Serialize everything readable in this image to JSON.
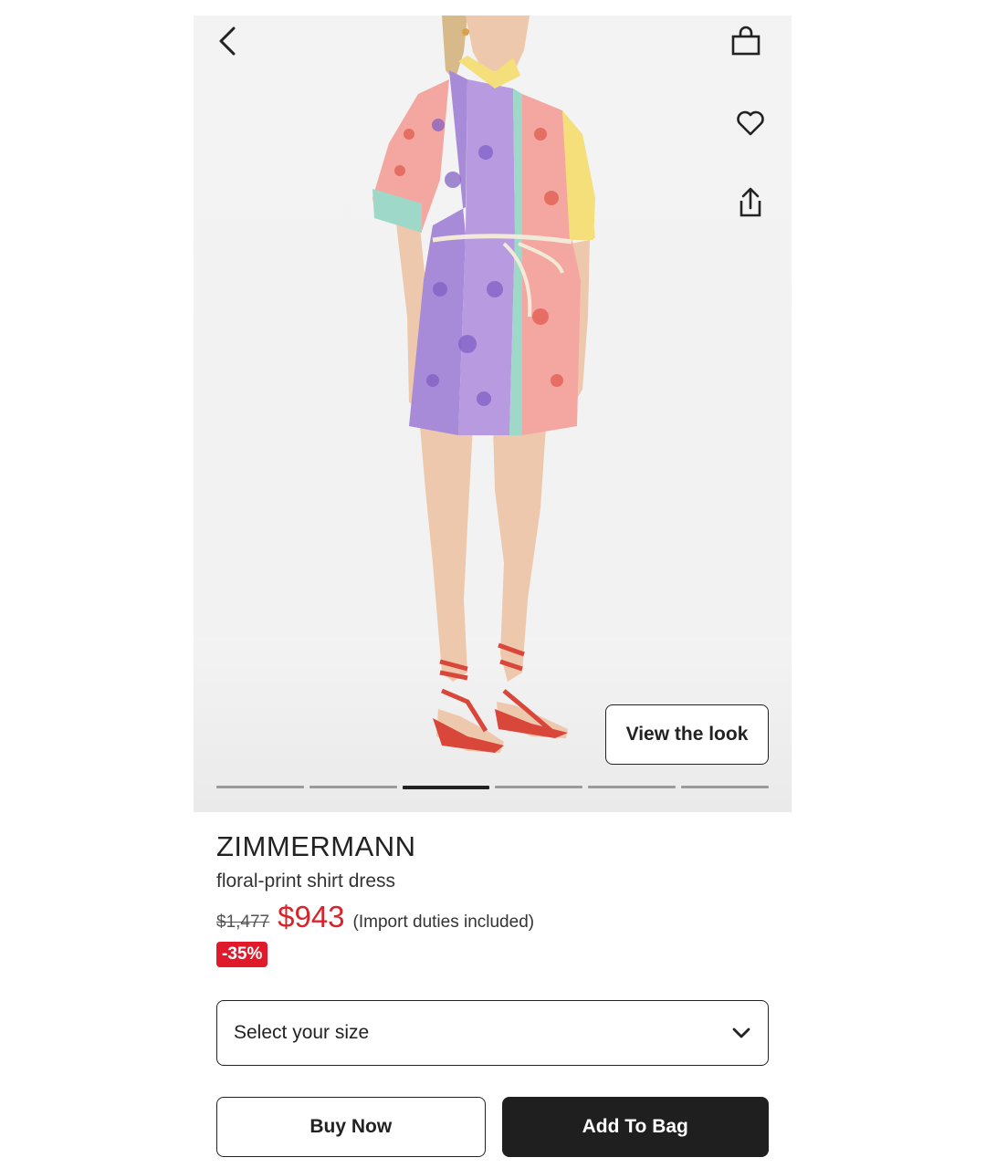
{
  "gallery": {
    "view_look_label": "View the look",
    "image_count": 6,
    "active_index": 2,
    "colors": {
      "background": "#f2f2f2",
      "skin": "#eec8ad",
      "hair": "#d8b98a",
      "sandal": "#d9463a",
      "purple": "#a78bd8",
      "pink": "#f4a7a0",
      "mint": "#9ed8c8",
      "yellow": "#f4df7a"
    }
  },
  "header": {
    "icons": [
      "chevron-left-icon",
      "shopping-bag-icon",
      "heart-icon",
      "share-icon"
    ]
  },
  "product": {
    "brand": "ZIMMERMANN",
    "name": "floral-print shirt dress",
    "old_price": "$1,477",
    "price": "$943",
    "duties_note": "(Import duties included)",
    "discount": "-35%"
  },
  "size_select": {
    "placeholder": "Select your size"
  },
  "actions": {
    "buy_now": "Buy Now",
    "add_to_bag": "Add To Bag"
  },
  "accent_colors": {
    "sale_red": "#d8232a",
    "discount_badge": "#e01a2b",
    "primary_button": "#1f1f1f"
  }
}
